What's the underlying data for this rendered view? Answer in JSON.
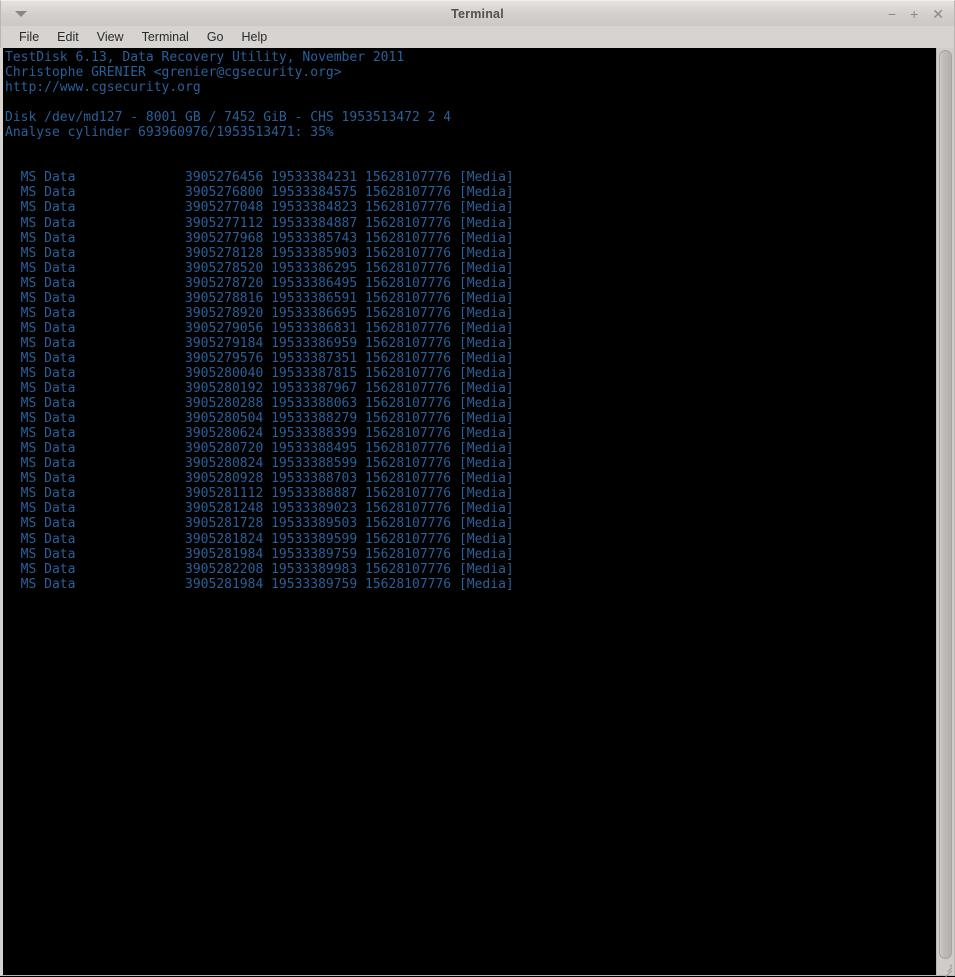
{
  "window": {
    "title": "Terminal",
    "menu_arrow_icon": "chevron-down-icon",
    "controls": {
      "minimize": "−",
      "maximize": "+",
      "close": "✕"
    }
  },
  "menubar": {
    "items": [
      {
        "label": "File"
      },
      {
        "label": "Edit"
      },
      {
        "label": "View"
      },
      {
        "label": "Terminal"
      },
      {
        "label": "Go"
      },
      {
        "label": "Help"
      }
    ]
  },
  "terminal": {
    "foreground_color": "#2a6099",
    "background_color": "#000000",
    "header": {
      "app_line": "TestDisk 6.13, Data Recovery Utility, November 2011",
      "author_line": "Christophe GRENIER <grenier@cgsecurity.org>",
      "url_line": "http://www.cgsecurity.org",
      "disk_line": "Disk /dev/md127 - 8001 GB / 7452 GiB - CHS 1953513472 2 4",
      "progress_line": "Analyse cylinder 693960976/1953513471: 35%"
    },
    "disk_info": {
      "device": "/dev/md127",
      "size_gb": "8001 GB",
      "size_gib": "7452 GiB",
      "chs": "1953513472 2 4"
    },
    "progress": {
      "current_cylinder": "693960976",
      "total_cylinders": "1953513471",
      "percent": "35%"
    },
    "partitions": [
      {
        "type": "MS Data",
        "start": "3905276456",
        "end": "19533384231",
        "size": "15628107776",
        "flag": "[Media]"
      },
      {
        "type": "MS Data",
        "start": "3905276800",
        "end": "19533384575",
        "size": "15628107776",
        "flag": "[Media]"
      },
      {
        "type": "MS Data",
        "start": "3905277048",
        "end": "19533384823",
        "size": "15628107776",
        "flag": "[Media]"
      },
      {
        "type": "MS Data",
        "start": "3905277112",
        "end": "19533384887",
        "size": "15628107776",
        "flag": "[Media]"
      },
      {
        "type": "MS Data",
        "start": "3905277968",
        "end": "19533385743",
        "size": "15628107776",
        "flag": "[Media]"
      },
      {
        "type": "MS Data",
        "start": "3905278128",
        "end": "19533385903",
        "size": "15628107776",
        "flag": "[Media]"
      },
      {
        "type": "MS Data",
        "start": "3905278520",
        "end": "19533386295",
        "size": "15628107776",
        "flag": "[Media]"
      },
      {
        "type": "MS Data",
        "start": "3905278720",
        "end": "19533386495",
        "size": "15628107776",
        "flag": "[Media]"
      },
      {
        "type": "MS Data",
        "start": "3905278816",
        "end": "19533386591",
        "size": "15628107776",
        "flag": "[Media]"
      },
      {
        "type": "MS Data",
        "start": "3905278920",
        "end": "19533386695",
        "size": "15628107776",
        "flag": "[Media]"
      },
      {
        "type": "MS Data",
        "start": "3905279056",
        "end": "19533386831",
        "size": "15628107776",
        "flag": "[Media]"
      },
      {
        "type": "MS Data",
        "start": "3905279184",
        "end": "19533386959",
        "size": "15628107776",
        "flag": "[Media]"
      },
      {
        "type": "MS Data",
        "start": "3905279576",
        "end": "19533387351",
        "size": "15628107776",
        "flag": "[Media]"
      },
      {
        "type": "MS Data",
        "start": "3905280040",
        "end": "19533387815",
        "size": "15628107776",
        "flag": "[Media]"
      },
      {
        "type": "MS Data",
        "start": "3905280192",
        "end": "19533387967",
        "size": "15628107776",
        "flag": "[Media]"
      },
      {
        "type": "MS Data",
        "start": "3905280288",
        "end": "19533388063",
        "size": "15628107776",
        "flag": "[Media]"
      },
      {
        "type": "MS Data",
        "start": "3905280504",
        "end": "19533388279",
        "size": "15628107776",
        "flag": "[Media]"
      },
      {
        "type": "MS Data",
        "start": "3905280624",
        "end": "19533388399",
        "size": "15628107776",
        "flag": "[Media]"
      },
      {
        "type": "MS Data",
        "start": "3905280720",
        "end": "19533388495",
        "size": "15628107776",
        "flag": "[Media]"
      },
      {
        "type": "MS Data",
        "start": "3905280824",
        "end": "19533388599",
        "size": "15628107776",
        "flag": "[Media]"
      },
      {
        "type": "MS Data",
        "start": "3905280928",
        "end": "19533388703",
        "size": "15628107776",
        "flag": "[Media]"
      },
      {
        "type": "MS Data",
        "start": "3905281112",
        "end": "19533388887",
        "size": "15628107776",
        "flag": "[Media]"
      },
      {
        "type": "MS Data",
        "start": "3905281248",
        "end": "19533389023",
        "size": "15628107776",
        "flag": "[Media]"
      },
      {
        "type": "MS Data",
        "start": "3905281728",
        "end": "19533389503",
        "size": "15628107776",
        "flag": "[Media]"
      },
      {
        "type": "MS Data",
        "start": "3905281824",
        "end": "19533389599",
        "size": "15628107776",
        "flag": "[Media]"
      },
      {
        "type": "MS Data",
        "start": "3905281984",
        "end": "19533389759",
        "size": "15628107776",
        "flag": "[Media]"
      },
      {
        "type": "MS Data",
        "start": "3905282208",
        "end": "19533389983",
        "size": "15628107776",
        "flag": "[Media]"
      },
      {
        "type": "MS Data",
        "start": "3905281984",
        "end": "19533389759",
        "size": "15628107776",
        "flag": "[Media]"
      }
    ]
  }
}
